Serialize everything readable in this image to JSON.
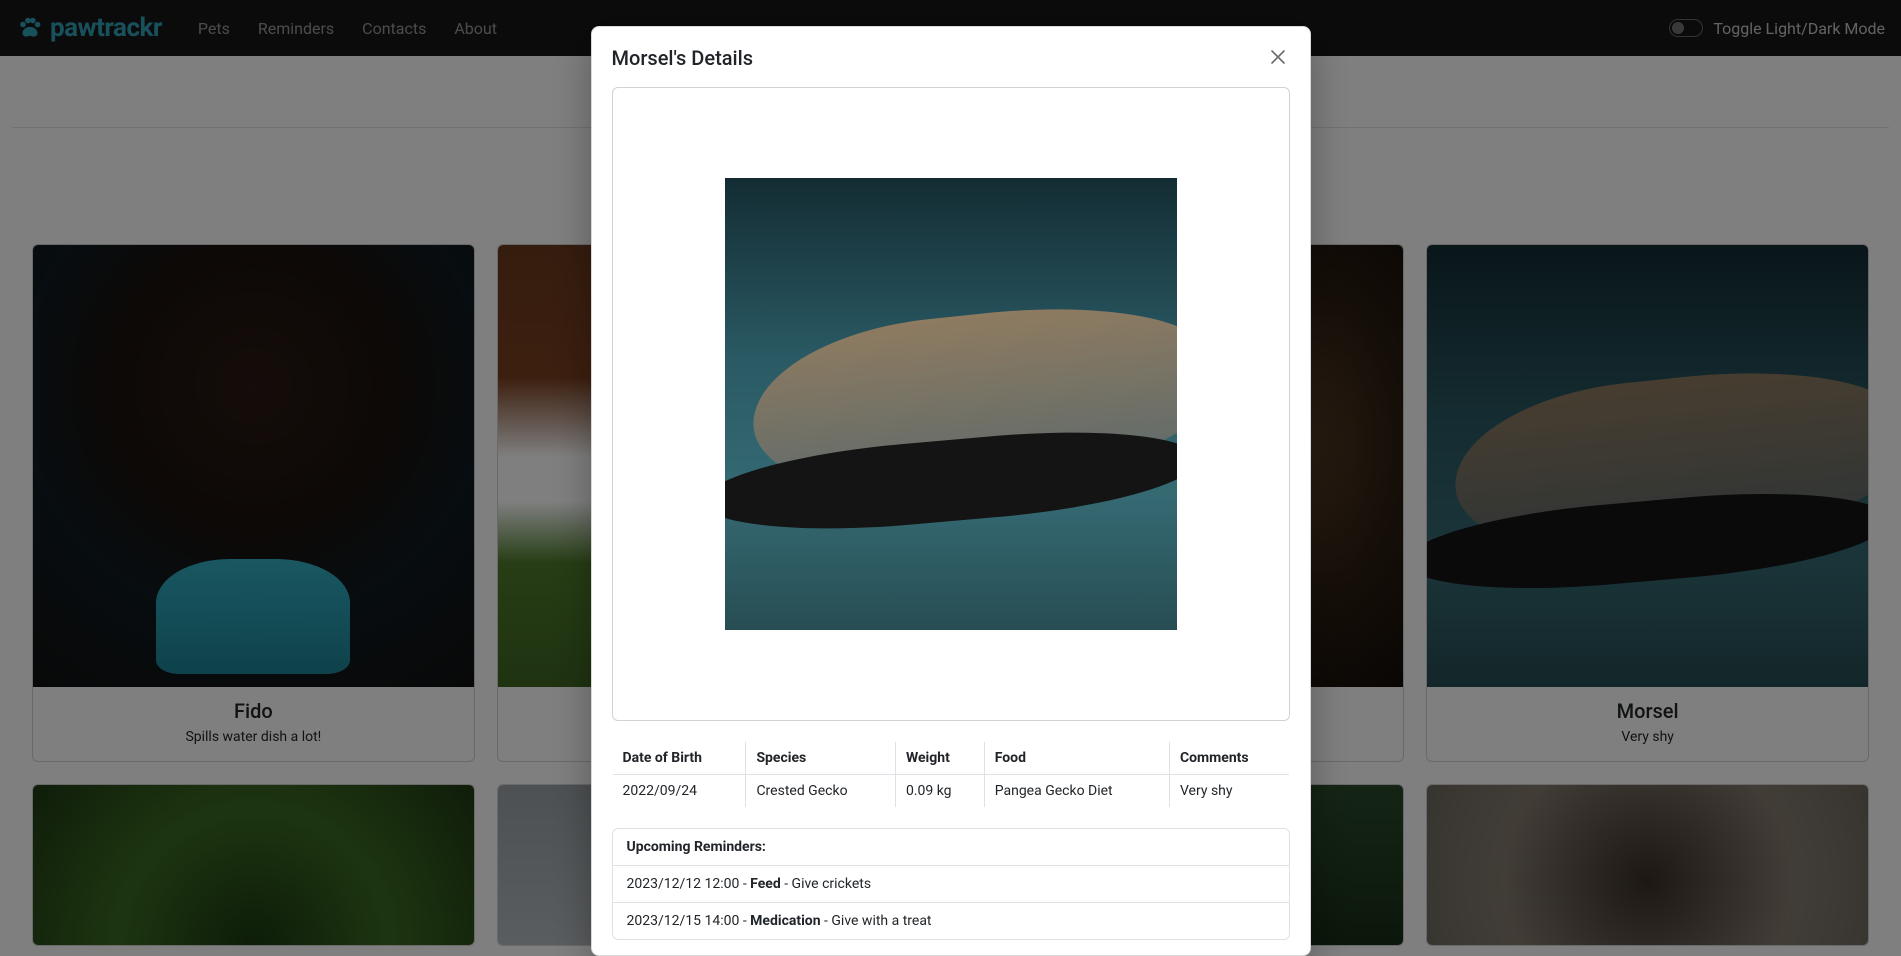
{
  "brand": {
    "name": "pawtrackr"
  },
  "nav": {
    "items": [
      {
        "label": "Pets"
      },
      {
        "label": "Reminders"
      },
      {
        "label": "Contacts"
      },
      {
        "label": "About"
      }
    ],
    "toggle_label": "Toggle Light/Dark Mode"
  },
  "pets": [
    {
      "name": "Fido",
      "desc": "Spills water dish a lot!"
    },
    {
      "name": "",
      "desc": ""
    },
    {
      "name": "",
      "desc": ""
    },
    {
      "name": "Morsel",
      "desc": "Very shy"
    }
  ],
  "modal": {
    "title": "Morsel's Details",
    "table": {
      "headers": {
        "dob": "Date of Birth",
        "species": "Species",
        "weight": "Weight",
        "food": "Food",
        "comments": "Comments"
      },
      "row": {
        "dob": "2022/09/24",
        "species": "Crested Gecko",
        "weight": "0.09 kg",
        "food": "Pangea Gecko Diet",
        "comments": "Very shy"
      }
    },
    "reminders": {
      "title": "Upcoming Reminders:",
      "items": [
        {
          "datetime": "2023/12/12 12:00",
          "sep1": " - ",
          "type": "Feed",
          "sep2": " - ",
          "note": "Give crickets"
        },
        {
          "datetime": "2023/12/15 14:00",
          "sep1": " - ",
          "type": "Medication",
          "sep2": " - ",
          "note": "Give with a treat"
        }
      ]
    }
  }
}
